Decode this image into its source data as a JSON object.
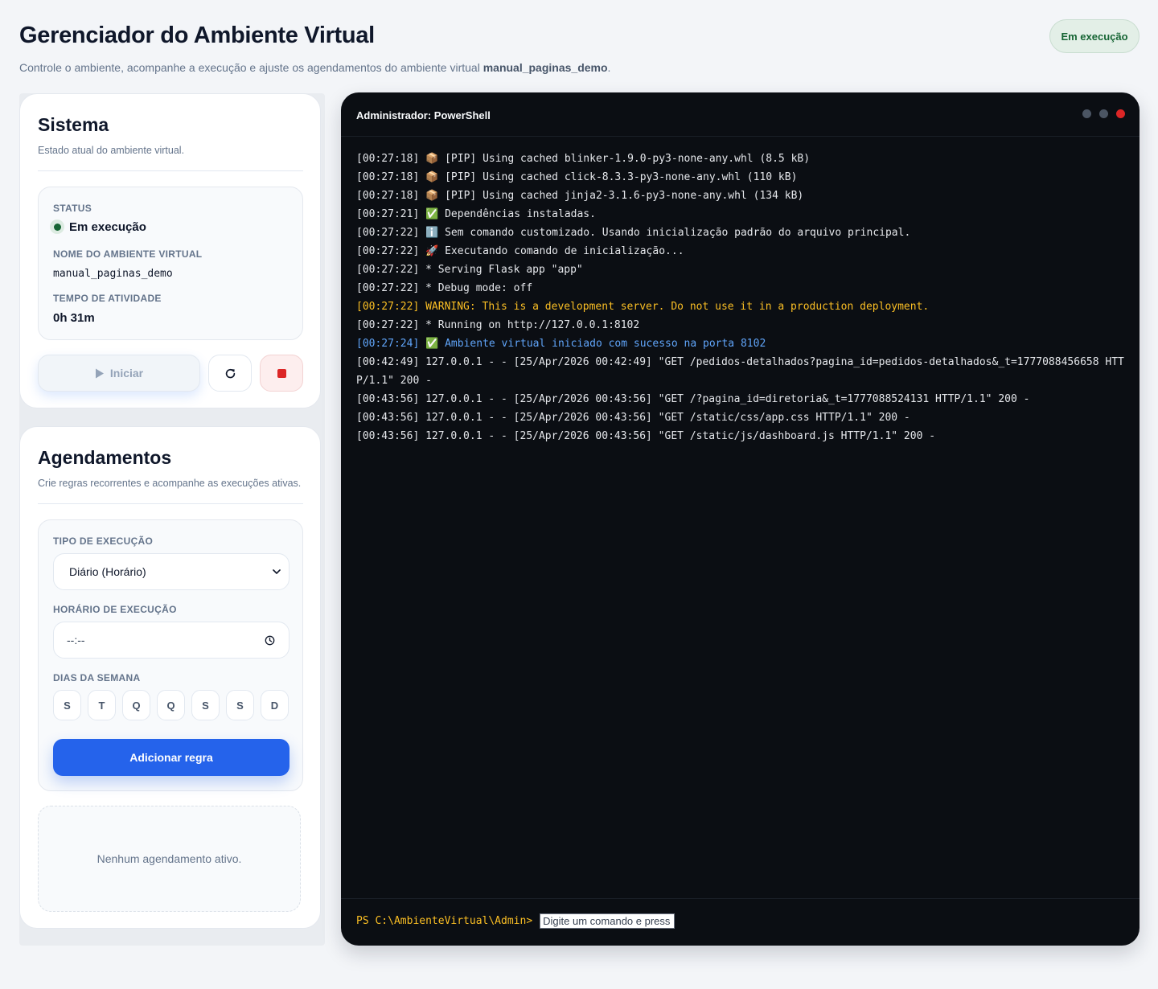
{
  "header": {
    "title": "Gerenciador do Ambiente Virtual",
    "subtitle_prefix": "Controle o ambiente, acompanhe a execução e ajuste os agendamentos do ambiente virtual ",
    "subtitle_env": "manual_paginas_demo",
    "subtitle_suffix": ".",
    "status_badge": "Em execução"
  },
  "sistema": {
    "title": "Sistema",
    "description": "Estado atual do ambiente virtual.",
    "status_label": "STATUS",
    "status_value": "Em execução",
    "env_name_label": "NOME DO AMBIENTE VIRTUAL",
    "env_name_value": "manual_paginas_demo",
    "uptime_label": "TEMPO DE ATIVIDADE",
    "uptime_value": "0h 31m",
    "start_button": "Iniciar"
  },
  "agendamentos": {
    "title": "Agendamentos",
    "description": "Crie regras recorrentes e acompanhe as execuções ativas.",
    "type_label": "TIPO DE EXECUÇÃO",
    "type_selected": "Diário (Horário)",
    "time_label": "HORÁRIO DE EXECUÇÃO",
    "time_value": "--:--",
    "days_label": "DIAS DA SEMANA",
    "days": [
      "S",
      "T",
      "Q",
      "Q",
      "S",
      "S",
      "D"
    ],
    "add_button": "Adicionar regra",
    "empty_message": "Nenhum agendamento ativo."
  },
  "terminal": {
    "title": "Administrador: PowerShell",
    "lines": [
      {
        "text": "[00:27:18] 📦 [PIP] Using cached blinker-1.9.0-py3-none-any.whl (8.5 kB)",
        "kind": "normal"
      },
      {
        "text": "[00:27:18] 📦 [PIP] Using cached click-8.3.3-py3-none-any.whl (110 kB)",
        "kind": "normal"
      },
      {
        "text": "[00:27:18] 📦 [PIP] Using cached jinja2-3.1.6-py3-none-any.whl (134 kB)",
        "kind": "normal"
      },
      {
        "text": "[00:27:21] ✅ Dependências instaladas.",
        "kind": "normal"
      },
      {
        "text": "[00:27:22] ℹ️ Sem comando customizado. Usando inicialização padrão do arquivo principal.",
        "kind": "normal"
      },
      {
        "text": "[00:27:22] 🚀 Executando comando de inicialização...",
        "kind": "normal"
      },
      {
        "text": "[00:27:22] * Serving Flask app \"app\"",
        "kind": "normal"
      },
      {
        "text": "[00:27:22] * Debug mode: off",
        "kind": "normal"
      },
      {
        "text": "[00:27:22] WARNING: This is a development server. Do not use it in a production deployment.",
        "kind": "warn"
      },
      {
        "text": "[00:27:22] * Running on http://127.0.0.1:8102",
        "kind": "normal"
      },
      {
        "text": "[00:27:24] ✅ Ambiente virtual iniciado com sucesso na porta 8102",
        "kind": "info"
      },
      {
        "text": "[00:42:49] 127.0.0.1 - - [25/Apr/2026 00:42:49] \"GET /pedidos-detalhados?pagina_id=pedidos-detalhados&_t=1777088456658 HTTP/1.1\" 200 -",
        "kind": "normal"
      },
      {
        "text": "[00:43:56] 127.0.0.1 - - [25/Apr/2026 00:43:56] \"GET /?pagina_id=diretoria&_t=1777088524131 HTTP/1.1\" 200 -",
        "kind": "normal"
      },
      {
        "text": "[00:43:56] 127.0.0.1 - - [25/Apr/2026 00:43:56] \"GET /static/css/app.css HTTP/1.1\" 200 -",
        "kind": "normal"
      },
      {
        "text": "[00:43:56] 127.0.0.1 - - [25/Apr/2026 00:43:56] \"GET /static/js/dashboard.js HTTP/1.1\" 200 -",
        "kind": "normal"
      }
    ],
    "prompt": "PS C:\\AmbienteVirtual\\Admin>",
    "input_placeholder": "Digite um comando e press"
  },
  "colors": {
    "accent": "#2563eb",
    "running": "#166534",
    "stop": "#dc2626",
    "warning": "#fbbf24",
    "info": "#60a5fa"
  },
  "icons": {
    "play": "play-icon",
    "restart": "restart-icon",
    "stop": "stop-icon",
    "chevron": "chevron-down-icon",
    "clock": "clock-icon"
  }
}
